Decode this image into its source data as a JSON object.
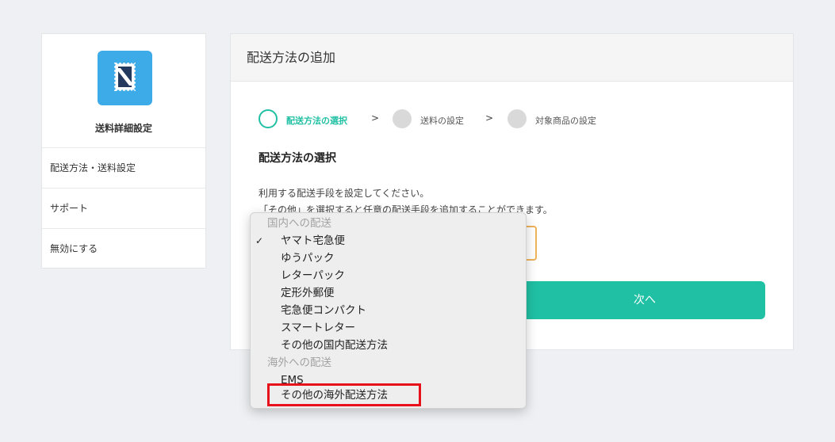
{
  "sidebar": {
    "app_icon": "stamp-icon",
    "app_name": "送料詳細設定",
    "items": [
      {
        "label": "配送方法・送料設定"
      },
      {
        "label": "サポート"
      },
      {
        "label": "無効にする"
      }
    ]
  },
  "panel": {
    "title": "配送方法の追加",
    "steps": [
      {
        "label": "配送方法の選択",
        "state": "active"
      },
      {
        "label": "送料の設定",
        "state": "inactive"
      },
      {
        "label": "対象商品の設定",
        "state": "inactive"
      }
    ],
    "section_title": "配送方法の選択",
    "description_1": "利用する配送手段を設定してください。",
    "description_2": "「その他」を選択すると任意の配送手段を追加することができます。",
    "next_label": "次へ"
  },
  "dropdown": {
    "group_domestic": "国内への配送",
    "domestic_options": [
      "ヤマト宅急便",
      "ゆうパック",
      "レターパック",
      "定形外郵便",
      "宅急便コンパクト",
      "スマートレター",
      "その他の国内配送方法"
    ],
    "selected": "ヤマト宅急便",
    "group_overseas": "海外への配送",
    "overseas_options": [
      "EMS",
      "その他の海外配送方法"
    ],
    "highlighted": "その他の海外配送方法"
  },
  "colors": {
    "accent": "#20c0a4",
    "app_icon_bg": "#3dabe8",
    "select_border": "#f0b25a",
    "highlight_border": "#e8101b",
    "inactive_step": "#d9d9d9"
  }
}
